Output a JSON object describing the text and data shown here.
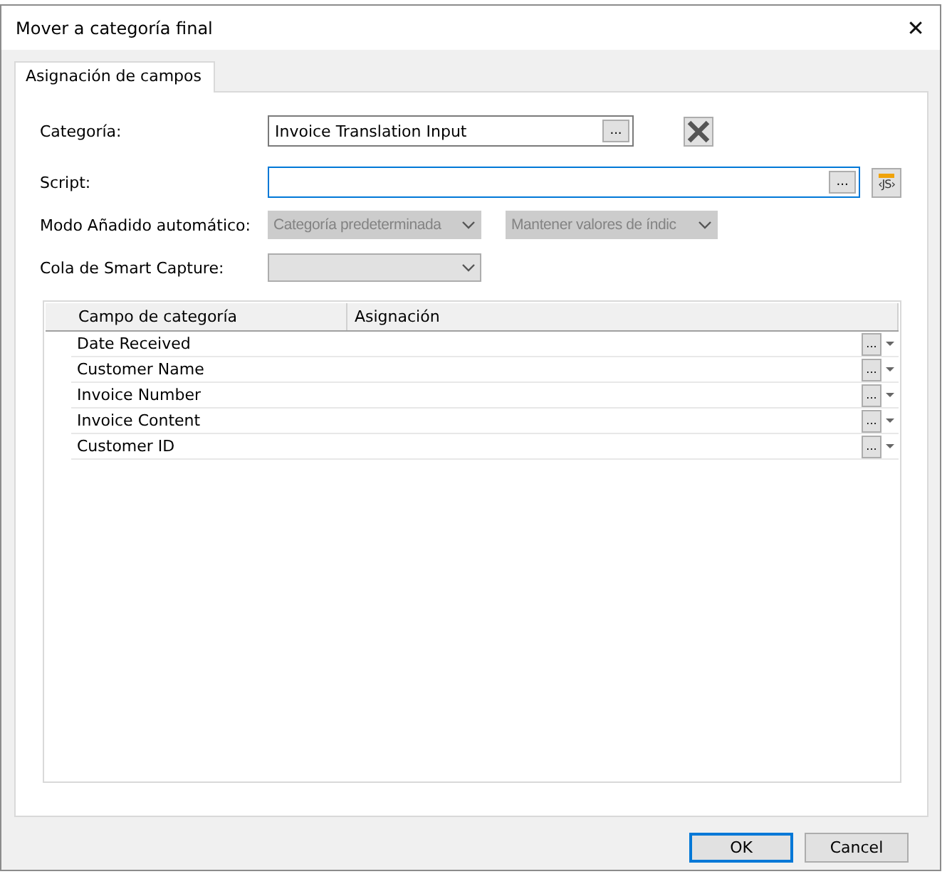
{
  "window": {
    "title": "Mover a categoría final",
    "close": "✕"
  },
  "tabs": [
    {
      "label": "Asignación de campos",
      "selected": true
    }
  ],
  "form": {
    "category": {
      "label": "Categoría:",
      "value": "Invoice Translation Input",
      "browse": "..."
    },
    "script": {
      "label": "Script:",
      "focused": true,
      "browse": "...",
      "js_button": "‹JS›"
    },
    "auto_mode": {
      "label": "Modo Añadido automático:",
      "dropdowns": [
        {
          "value": "Categoría predeterminada",
          "disabled": true
        },
        {
          "value": "Mantener valores de índic",
          "disabled": true
        }
      ]
    },
    "queue": {
      "label": "Cola de Smart Capture:",
      "disabled": false
    }
  },
  "table": {
    "columns": [
      "Campo de categoría",
      "Asignación"
    ],
    "rows": [
      {
        "field": "Date Received",
        "browse": "..."
      },
      {
        "field": "Customer Name",
        "browse": "..."
      },
      {
        "field": "Invoice Number",
        "browse": "..."
      },
      {
        "field": "Invoice Content",
        "browse": "..."
      },
      {
        "field": "Customer ID",
        "browse": "..."
      }
    ]
  },
  "buttons": [
    {
      "label": "OK",
      "default": true
    },
    {
      "label": "Cancel",
      "default": false
    }
  ]
}
